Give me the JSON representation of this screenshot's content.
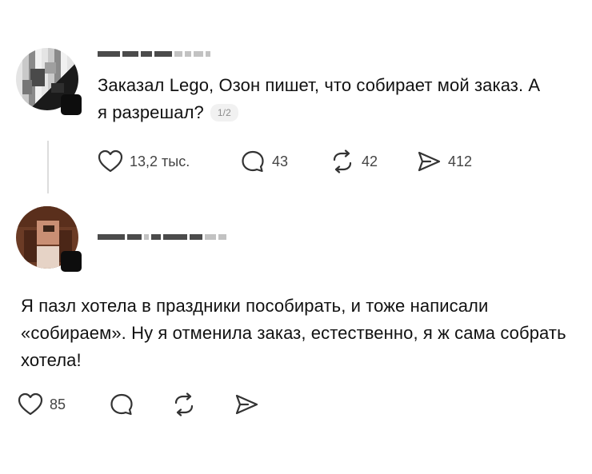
{
  "post1": {
    "text": "Заказал Lego, Озон пишет, что собирает мой заказ. А я разрешал?",
    "page_counter": "1/2",
    "likes": "13,2 тыс.",
    "replies": "43",
    "reposts": "42",
    "shares": "412"
  },
  "post2": {
    "text": "Я пазл хотела в праздники пособирать, и тоже написали «собираем». Ну я отменила заказ, естественно, я ж сама собрать хотела!",
    "likes": "85"
  },
  "icons": {
    "like": "heart-icon",
    "reply": "speech-bubble-icon",
    "repost": "repost-arrows-icon",
    "share": "send-icon"
  }
}
